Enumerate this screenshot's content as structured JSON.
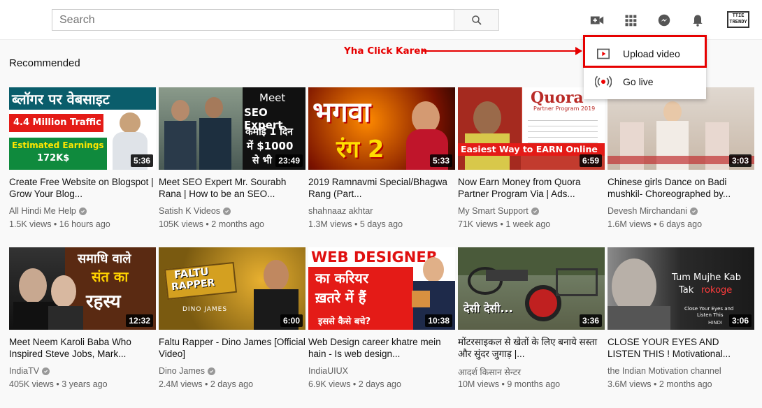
{
  "search": {
    "placeholder": "Search"
  },
  "header": {
    "logo_text": "TTIE TRENDY"
  },
  "section": {
    "title": "Recommended"
  },
  "menu": {
    "items": [
      {
        "label": "Upload video",
        "icon": "upload-video-icon"
      },
      {
        "label": "Go live",
        "icon": "go-live-icon"
      }
    ]
  },
  "annotation": {
    "text": "Yha Click Karen"
  },
  "videos": [
    {
      "title": "Create Free Website on Blogspot | Grow Your Blog...",
      "channel": "All Hindi Me Help",
      "views": "1.5K views",
      "age": "16 hours ago",
      "duration": "5:36",
      "thumb": {
        "t1": "ब्लॉगर पर वेबसाइट",
        "t2": "4.4 Million Traffic",
        "t3": "Estimated Earnings",
        "t4": "172K$"
      }
    },
    {
      "title": "Meet SEO Expert Mr. Sourabh Rana | How to be an SEO...",
      "channel": "Satish K Videos",
      "views": "105K views",
      "age": "2 months ago",
      "duration": "23:49",
      "thumb": {
        "t1": "Meet",
        "t2": "SEO Expert",
        "t3": "कमाई 1 दिन",
        "t4": "में $1000",
        "t5": "से भी"
      }
    },
    {
      "title": "2019 Ramnavmi Special/Bhagwa Rang (Part...",
      "channel": "shahnaaz akhtar",
      "views": "1.3M views",
      "age": "5 days ago",
      "duration": "5:33",
      "thumb": {
        "t1": "भगवा",
        "t2": "रंग 2"
      }
    },
    {
      "title": "Now Earn Money from Quora Partner Program Via | Ads...",
      "channel": "My Smart Support",
      "views": "71K views",
      "age": "1 week ago",
      "duration": "6:59",
      "thumb": {
        "t1": "Quora",
        "t2": "Partner Program 2019",
        "t3": "Easiest Way to EARN Online"
      }
    },
    {
      "title": "Chinese girls Dance on Badi mushkil- Choreographed by...",
      "channel": "Devesh Mirchandani",
      "views": "1.6M views",
      "age": "6 days ago",
      "duration": "3:03",
      "thumb": {}
    },
    {
      "title": "Meet Neem Karoli Baba Who Inspired Steve Jobs, Mark...",
      "channel": "IndiaTV",
      "views": "405K views",
      "age": "3 years ago",
      "duration": "12:32",
      "thumb": {
        "t1": "समाधि वाले",
        "t2": "संत का",
        "t3": "रहस्य"
      }
    },
    {
      "title": "Faltu Rapper - Dino James [Official Video]",
      "channel": "Dino James",
      "views": "2.4M views",
      "age": "2 days ago",
      "duration": "6:00",
      "thumb": {
        "t1": "FALTU",
        "t2": "RAPPER",
        "t3": "DINO JAMES"
      }
    },
    {
      "title": "Web Design career khatre mein hain - Is web design...",
      "channel": "IndiaUIUX",
      "views": "6.9K views",
      "age": "2 days ago",
      "duration": "10:38",
      "thumb": {
        "t1": "WEB DESIGNER",
        "t2": "का करियर",
        "t3": "ख़तरे में हैं",
        "t4": "इससे कैसे बचे?"
      }
    },
    {
      "title": "मोंटरसाइकल से खेतों के लिए बनाये सस्ता और सुंदर जुगाड़ |...",
      "channel": "आदर्श किसान सेन्टर",
      "views": "10M views",
      "age": "9 months ago",
      "duration": "3:36",
      "thumb": {
        "t1": "देसी देसी..."
      }
    },
    {
      "title": "CLOSE YOUR EYES AND LISTEN THIS ! Motivational...",
      "channel": "the Indian Motivation channel",
      "views": "3.6M views",
      "age": "2 months ago",
      "duration": "3:06",
      "thumb": {
        "t1": "Tum Mujhe Kab",
        "t2": "Tak",
        "t3": "rokoge",
        "t4": "Close Your Eyes and",
        "t5": "Listen This",
        "t6": "HINDI"
      }
    }
  ]
}
